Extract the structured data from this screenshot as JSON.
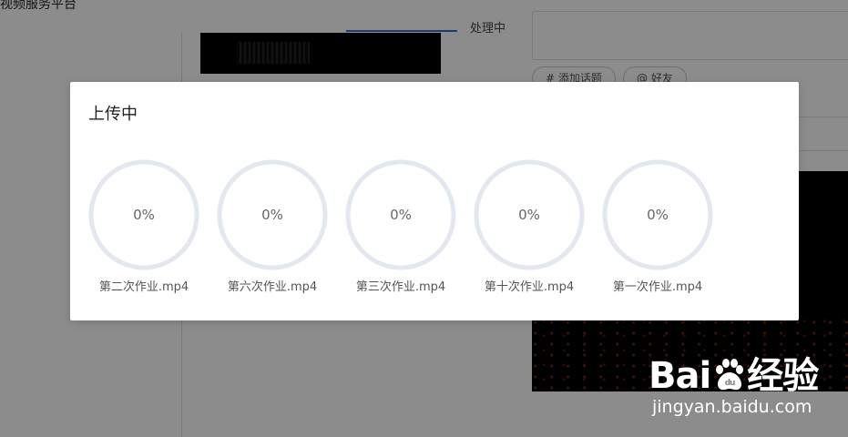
{
  "background": {
    "partial_title": "视频服务平台",
    "status_text": "处理中",
    "tags": [
      "# 添加话题",
      "@ 好友"
    ]
  },
  "modal": {
    "title": "上传中",
    "uploads": [
      {
        "progress_label": "0%",
        "progress": 0,
        "filename": "第二次作业.mp4"
      },
      {
        "progress_label": "0%",
        "progress": 0,
        "filename": "第六次作业.mp4"
      },
      {
        "progress_label": "0%",
        "progress": 0,
        "filename": "第三次作业.mp4"
      },
      {
        "progress_label": "0%",
        "progress": 0,
        "filename": "第十次作业.mp4"
      },
      {
        "progress_label": "0%",
        "progress": 0,
        "filename": "第一次作业.mp4"
      }
    ]
  },
  "watermark": {
    "logo_text_a": "Bai",
    "logo_text_b": "经验",
    "logo_icon": "paw-icon",
    "url": "jingyan.baidu.com"
  },
  "colors": {
    "ring_track": "#e3e7f0",
    "ring_progress": "#2a6fd6",
    "overlay": "#000000"
  }
}
